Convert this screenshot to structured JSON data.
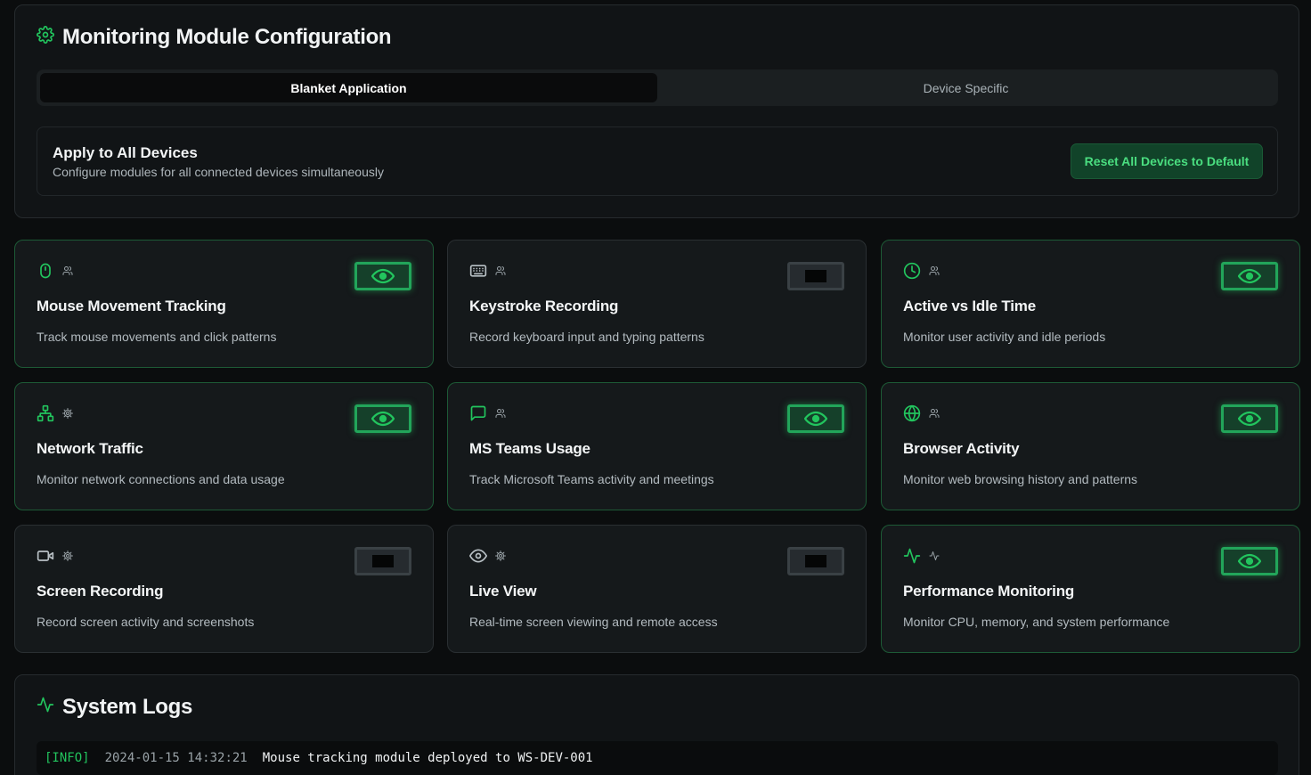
{
  "config": {
    "title": "Monitoring Module Configuration",
    "tabs": [
      {
        "label": "Blanket Application",
        "active": true
      },
      {
        "label": "Device Specific",
        "active": false
      }
    ],
    "apply": {
      "title": "Apply to All Devices",
      "description": "Configure modules for all connected devices simultaneously",
      "reset_label": "Reset All Devices to Default"
    }
  },
  "modules": [
    {
      "title": "Mouse Movement Tracking",
      "description": "Track mouse movements and click patterns",
      "icon": "mouse-icon",
      "sub_icon": "users-icon",
      "enabled": true
    },
    {
      "title": "Keystroke Recording",
      "description": "Record keyboard input and typing patterns",
      "icon": "keyboard-icon",
      "sub_icon": "users-icon",
      "enabled": false
    },
    {
      "title": "Active vs Idle Time",
      "description": "Monitor user activity and idle periods",
      "icon": "clock-icon",
      "sub_icon": "users-icon",
      "enabled": true
    },
    {
      "title": "Network Traffic",
      "description": "Monitor network connections and data usage",
      "icon": "network-icon",
      "sub_icon": "gear-icon",
      "enabled": true
    },
    {
      "title": "MS Teams Usage",
      "description": "Track Microsoft Teams activity and meetings",
      "icon": "chat-icon",
      "sub_icon": "users-icon",
      "enabled": true
    },
    {
      "title": "Browser Activity",
      "description": "Monitor web browsing history and patterns",
      "icon": "globe-icon",
      "sub_icon": "users-icon",
      "enabled": true
    },
    {
      "title": "Screen Recording",
      "description": "Record screen activity and screenshots",
      "icon": "video-icon",
      "sub_icon": "gear-icon",
      "enabled": false
    },
    {
      "title": "Live View",
      "description": "Real-time screen viewing and remote access",
      "icon": "eye-icon",
      "sub_icon": "gear-icon",
      "enabled": false
    },
    {
      "title": "Performance Monitoring",
      "description": "Monitor CPU, memory, and system performance",
      "icon": "activity-icon",
      "sub_icon": "activity-icon",
      "enabled": true
    }
  ],
  "logs": {
    "title": "System Logs",
    "entries": [
      {
        "level": "[INFO]",
        "time": "2024-01-15 14:32:21",
        "message": "Mouse tracking module deployed to WS-DEV-001"
      }
    ]
  },
  "colors": {
    "accent": "#22c55e",
    "toggle_on_border": "#22a55a",
    "toggle_off_border": "#3a4145"
  }
}
